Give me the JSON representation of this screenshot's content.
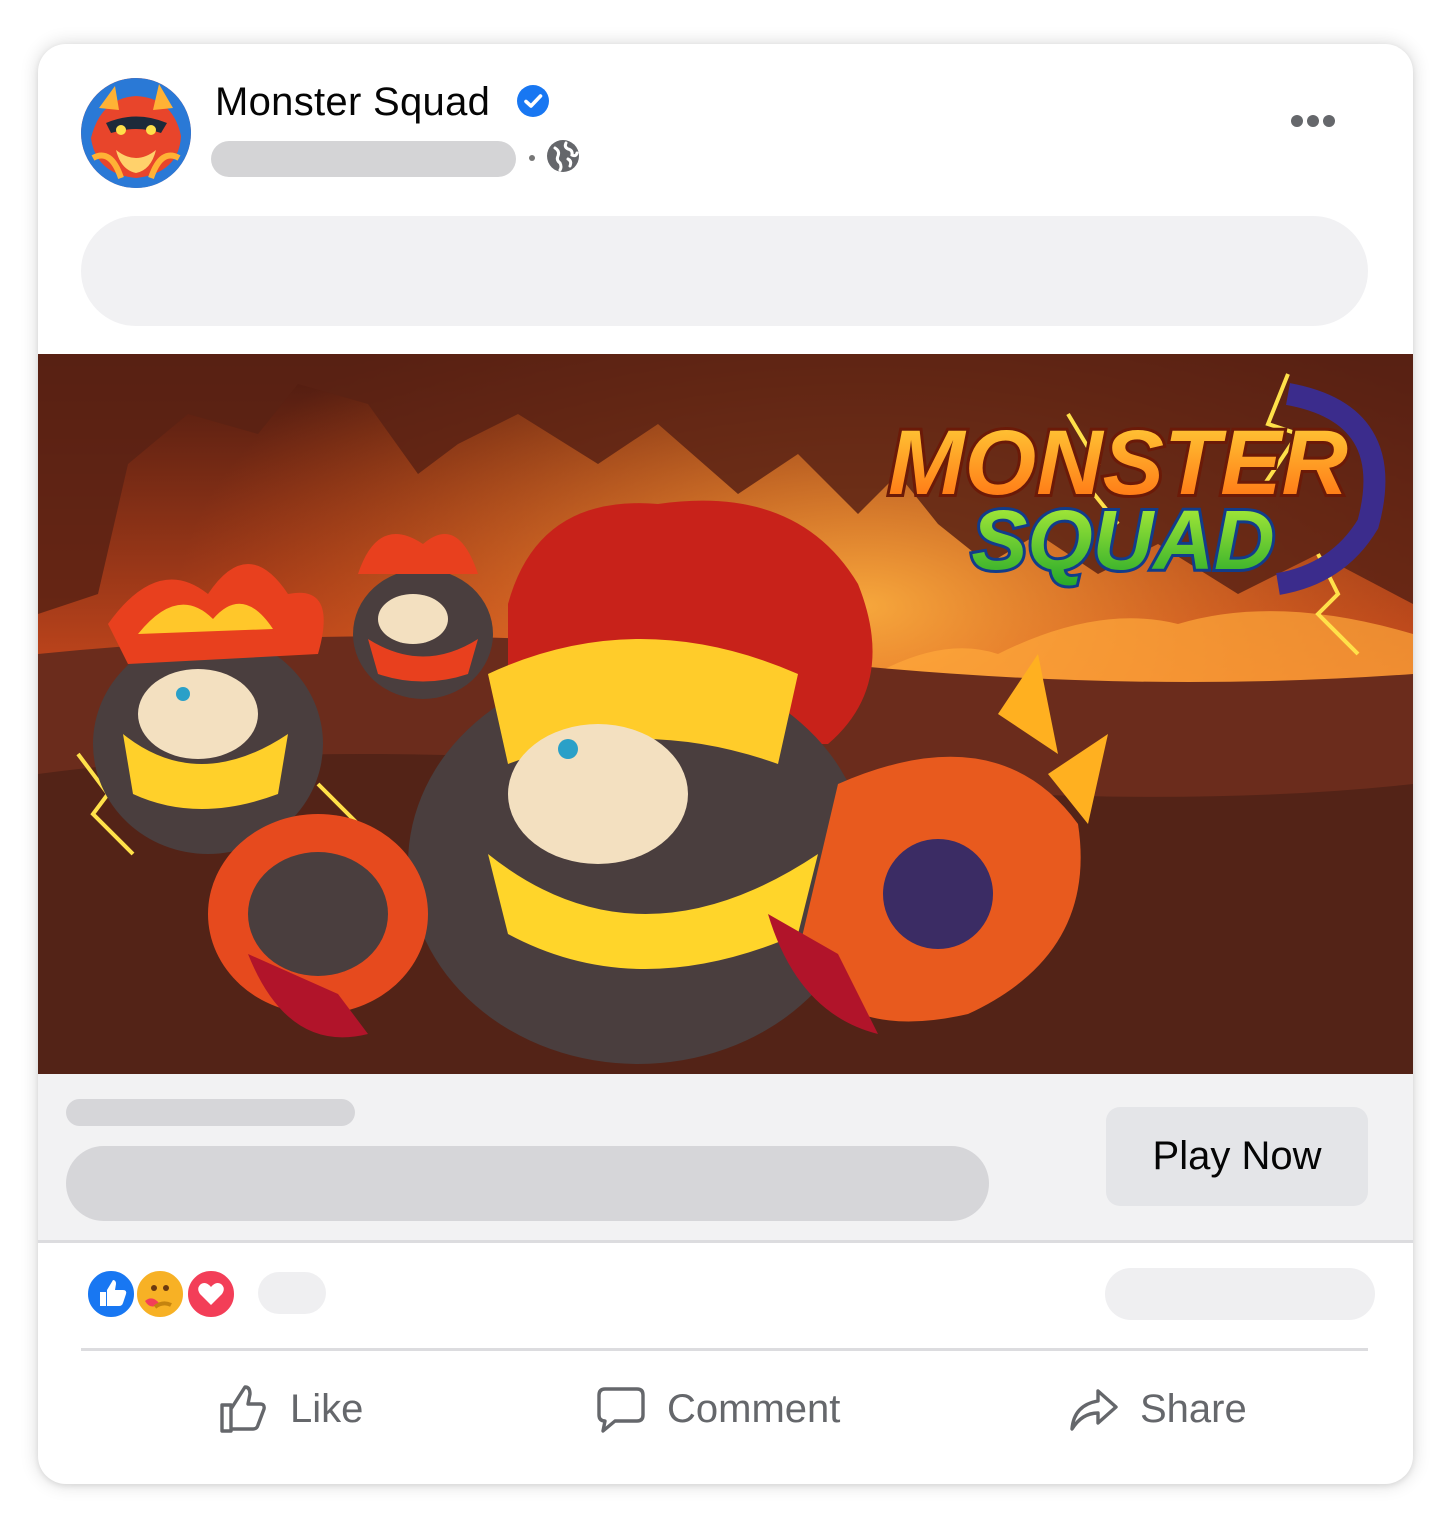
{
  "post": {
    "page_name": "Monster Squad",
    "verified_icon": "verified-badge-icon",
    "audience_icon": "globe-icon",
    "more_icon": "more-horizontal-icon"
  },
  "media": {
    "logo_line1": "MONSTER",
    "logo_line2": "SQUAD"
  },
  "cta": {
    "button_label": "Play Now"
  },
  "reactions": {
    "icons": [
      "like-reaction-icon",
      "care-reaction-icon",
      "love-reaction-icon"
    ]
  },
  "actions": {
    "like_label": "Like",
    "comment_label": "Comment",
    "share_label": "Share"
  },
  "colors": {
    "verified_blue": "#1877f2",
    "like_blue": "#1877f2",
    "love_red": "#f33e58",
    "care_yellow": "#f7b125",
    "action_gray": "#65676b",
    "logo_orange": "#ff8a1a",
    "logo_green": "#3fce3a"
  }
}
